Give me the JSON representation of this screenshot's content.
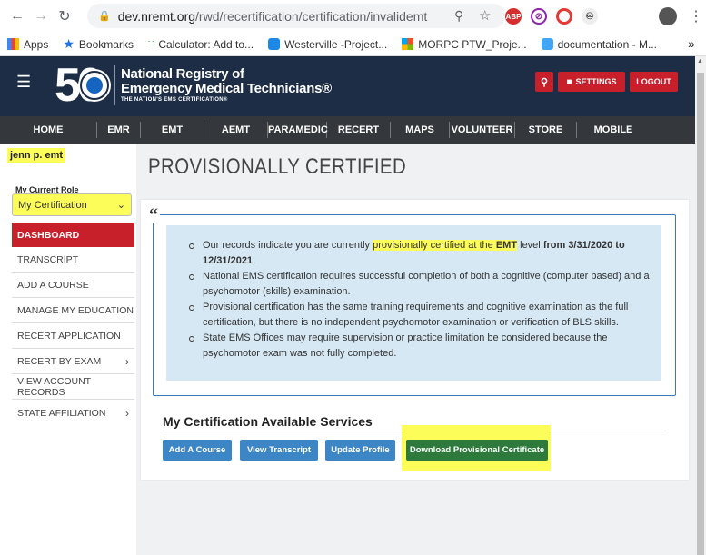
{
  "browser": {
    "url_host": "dev.nremt.org",
    "url_path": "/rwd/recertification/certification/invalidemt",
    "bookmarks": [
      {
        "label": "Apps",
        "icon": "apps-grid-icon"
      },
      {
        "label": "Bookmarks",
        "icon": "star-icon"
      },
      {
        "label": "Calculator: Add to...",
        "icon": "calculator-icon"
      },
      {
        "label": "Westerville -Project...",
        "icon": "westerville-icon"
      },
      {
        "label": "MORPC PTW_Proje...",
        "icon": "windows-icon"
      },
      {
        "label": "documentation - M...",
        "icon": "documentation-icon"
      }
    ],
    "overflow": "»",
    "extensions": [
      "ABP",
      "block",
      "opera",
      "acrobat",
      "avatar"
    ]
  },
  "header": {
    "logo_number": "50",
    "logo_line1": "National Registry of",
    "logo_line2": "Emergency Medical Technicians®",
    "logo_tagline": "THE NATION'S EMS CERTIFICATION®",
    "settings_label": "SETTINGS",
    "logout_label": "LOGOUT"
  },
  "nav": [
    "HOME",
    "EMR",
    "EMT",
    "AEMT",
    "PARAMEDIC",
    "RECERT",
    "MAPS",
    "VOLUNTEER",
    "STORE",
    "MOBILE"
  ],
  "sidebar": {
    "user_name": "jenn p. emt",
    "role_label": "My Current Role",
    "role_value": "My Certification",
    "items": [
      {
        "label": "DASHBOARD",
        "active": true
      },
      {
        "label": "TRANSCRIPT"
      },
      {
        "label": "ADD A COURSE"
      },
      {
        "label": "MANAGE MY EDUCATION"
      },
      {
        "label": "RECERT APPLICATION"
      },
      {
        "label": "RECERT BY EXAM",
        "has_arrow": true
      },
      {
        "label": "VIEW ACCOUNT RECORDS"
      },
      {
        "label": "STATE AFFILIATION",
        "has_arrow": true
      }
    ]
  },
  "main": {
    "page_title": "PROVISIONALLY CERTIFIED",
    "quote_mark": "“",
    "bullet1_pre": "Our records indicate you are currently ",
    "bullet1_hl": "provisionally certified at the ",
    "bullet1_level": "EMT",
    "bullet1_mid": " level ",
    "bullet1_date": "from 3/31/2020 to 12/31/2021",
    "bullet1_end": ".",
    "bullet2": "National EMS certification requires successful completion of both a cognitive (computer based) and a psychomotor (skills) examination.",
    "bullet3": "Provisional certification has the same training requirements and cognitive examination as the full certification, but there is no independent psychomotor examination or verification of BLS skills.",
    "bullet4": "State EMS Offices may require supervision or practice limitation be considered because the psychomotor exam was not fully completed.",
    "services_title": "My Certification Available Services",
    "buttons": {
      "add_course": "Add A Course",
      "view_transcript": "View Transcript",
      "update_profile": "Update Profile",
      "download_certificate": "Download Provisional Certificate"
    }
  },
  "colors": {
    "header_bg": "#1c2d45",
    "nav_bg": "#34373b",
    "accent_red": "#c8202a",
    "button_blue": "#3d86c6",
    "button_green": "#2d7a3c",
    "highlight_yellow": "#fdfd5a",
    "info_bg": "#d6e8f4"
  }
}
